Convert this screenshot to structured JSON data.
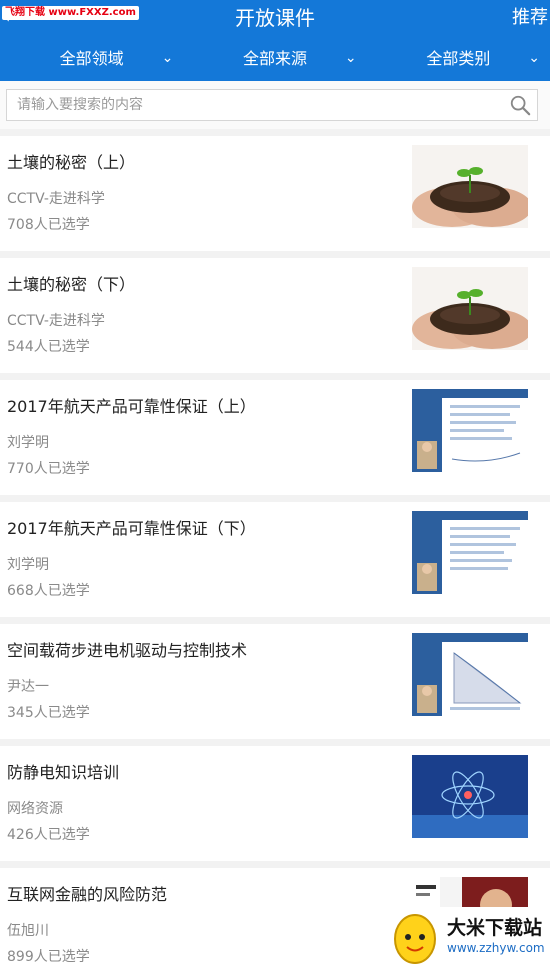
{
  "header": {
    "title": "开放课件",
    "right_link": "推荐",
    "watermark": "飞翔下载 www.FXXZ.com"
  },
  "filters": [
    {
      "label": "全部领域"
    },
    {
      "label": "全部来源"
    },
    {
      "label": "全部类别"
    }
  ],
  "search": {
    "placeholder": "请输入要搜索的内容",
    "value": ""
  },
  "courses": [
    {
      "title": "土壤的秘密（上）",
      "source": "CCTV-走进科学",
      "count": "708人已选学",
      "thumb": "soil-hands"
    },
    {
      "title": "土壤的秘密（下）",
      "source": "CCTV-走进科学",
      "count": "544人已选学",
      "thumb": "soil-hands"
    },
    {
      "title": "2017年航天产品可靠性保证（上）",
      "source": "刘学明",
      "count": "770人已选学",
      "thumb": "lecture-slide"
    },
    {
      "title": "2017年航天产品可靠性保证（下）",
      "source": "刘学明",
      "count": "668人已选学",
      "thumb": "lecture-slide"
    },
    {
      "title": "空间载荷步进电机驱动与控制技术",
      "source": "尹达一",
      "count": "345人已选学",
      "thumb": "lecture-slide"
    },
    {
      "title": "防静电知识培训",
      "source": "网络资源",
      "count": "426人已选学",
      "thumb": "atom-blue"
    },
    {
      "title": "互联网金融的风险防范",
      "source": "伍旭川",
      "count": "899人已选学",
      "thumb": "speaker"
    }
  ],
  "badge": {
    "title": "大米下载站",
    "url": "www.zzhyw.com"
  },
  "colors": {
    "primary": "#1478d8",
    "background": "#f2f2f2"
  }
}
